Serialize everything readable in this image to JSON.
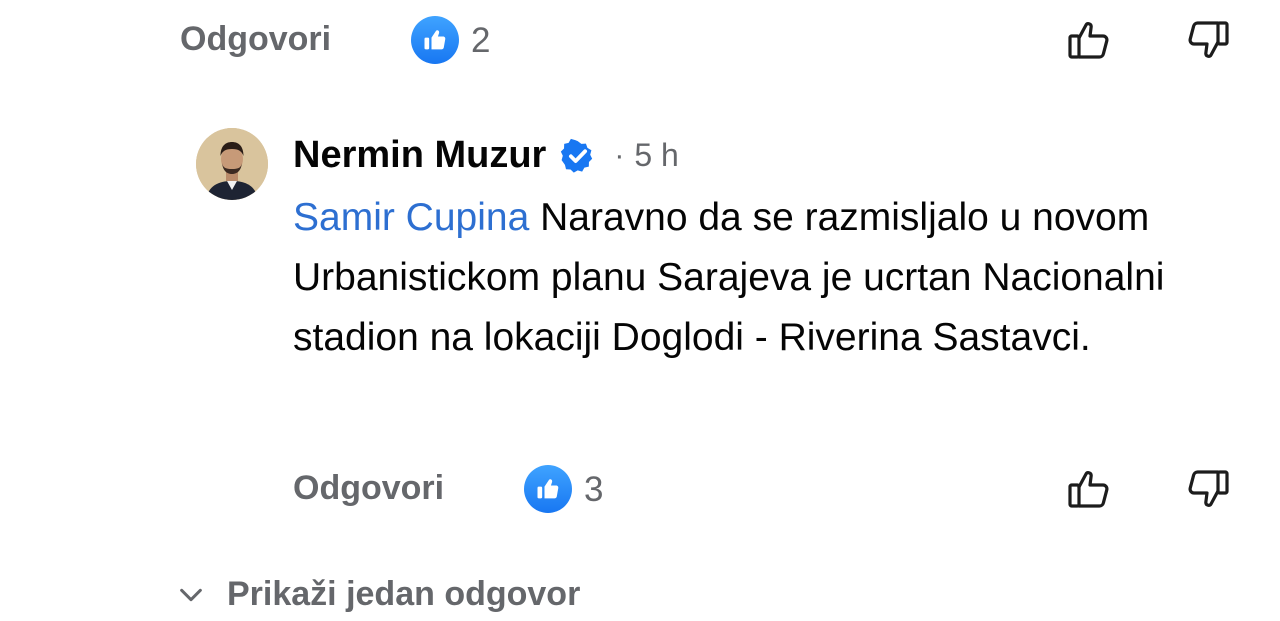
{
  "top_actions": {
    "reply_label": "Odgovori",
    "like_count": "2"
  },
  "comment": {
    "author": "Nermin Muzur",
    "separator": "·",
    "time": "5 h",
    "mention": "Samir Cupina",
    "text": " Naravno da se razmisljalo u novom Urbanistickom planu Sarajeva je ucrtan Nacionalni stadion na lokaciji Doglodi - Riverina Sastavci.",
    "reply_label": "Odgovori",
    "like_count": "3"
  },
  "show_replies": {
    "label": "Prikaži jedan odgovor"
  },
  "colors": {
    "accent": "#1877f2",
    "mention": "#2d6fd1",
    "secondary_text": "#65676b"
  }
}
